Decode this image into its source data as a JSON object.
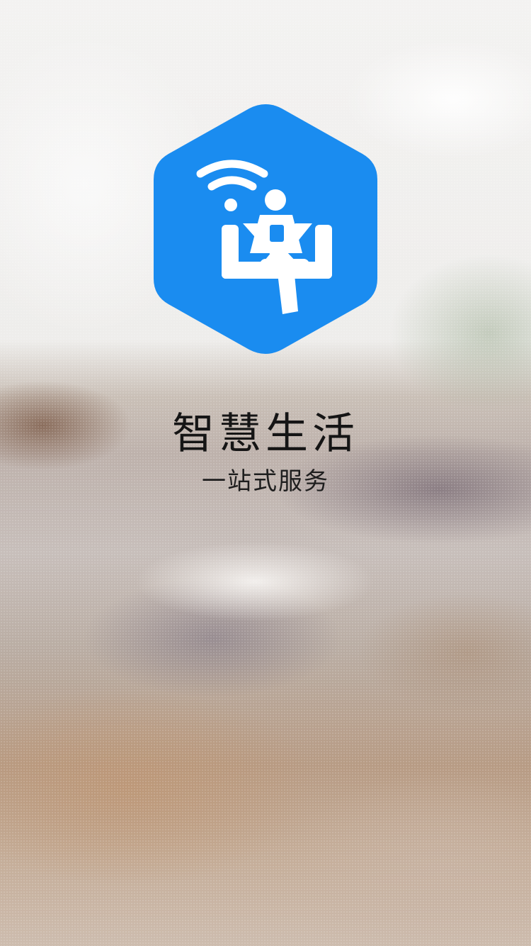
{
  "app": {
    "title": "智慧生活",
    "subtitle": "一站式服务"
  },
  "logo": {
    "icon": "wifi-person-sofa-icon",
    "color": "#1a8cf0",
    "glyph_color": "#ffffff"
  }
}
